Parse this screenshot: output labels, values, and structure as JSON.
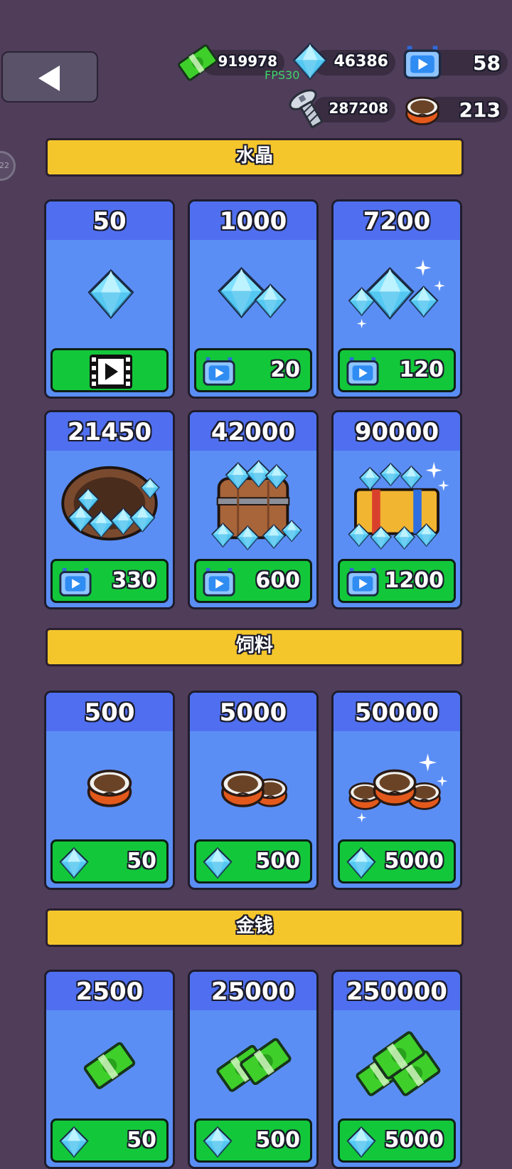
{
  "topbar": {
    "fps": "FPS30",
    "money": "919978",
    "crystals": "46386",
    "tickets": "58",
    "screws": "287208",
    "food": "213",
    "side_badge": "22"
  },
  "sections": [
    {
      "title": "水晶",
      "cards": [
        {
          "amount": "50",
          "price": "",
          "cost_type": "video-ad"
        },
        {
          "amount": "1000",
          "price": "20",
          "cost_type": "ticket"
        },
        {
          "amount": "7200",
          "price": "120",
          "cost_type": "ticket"
        },
        {
          "amount": "21450",
          "price": "330",
          "cost_type": "ticket"
        },
        {
          "amount": "42000",
          "price": "600",
          "cost_type": "ticket"
        },
        {
          "amount": "90000",
          "price": "1200",
          "cost_type": "ticket"
        }
      ]
    },
    {
      "title": "饲料",
      "cards": [
        {
          "amount": "500",
          "price": "50",
          "cost_type": "crystal"
        },
        {
          "amount": "5000",
          "price": "500",
          "cost_type": "crystal"
        },
        {
          "amount": "50000",
          "price": "5000",
          "cost_type": "crystal"
        }
      ]
    },
    {
      "title": "金钱",
      "cards": [
        {
          "amount": "2500",
          "price": "50",
          "cost_type": "crystal"
        },
        {
          "amount": "25000",
          "price": "500",
          "cost_type": "crystal"
        },
        {
          "amount": "250000",
          "price": "5000",
          "cost_type": "crystal"
        }
      ]
    }
  ],
  "colors": {
    "background": "#4f3d5a",
    "header": "#f5c62c",
    "card": "#5b8ef5",
    "card_top": "#4f6ff0",
    "buy_button": "#12c83a"
  }
}
